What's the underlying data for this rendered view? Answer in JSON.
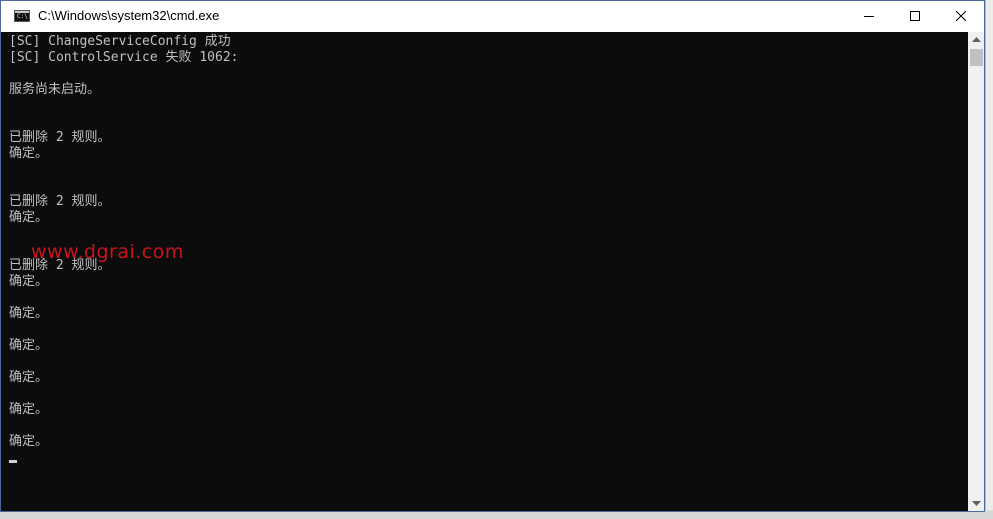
{
  "window": {
    "title": "C:\\Windows\\system32\\cmd.exe",
    "icon": "cmd-icon",
    "icon_glyph": "C:\\",
    "controls": {
      "minimize": "minimize-icon",
      "maximize": "maximize-icon",
      "close": "close-icon"
    }
  },
  "console": {
    "lines": [
      "[SC] ChangeServiceConfig 成功",
      "[SC] ControlService 失败 1062:",
      "服务尚未启动。",
      "已删除 2 规则。",
      "确定。",
      "已删除 2 规则。",
      "确定。",
      "已删除 2 规则。",
      "确定。",
      "确定。",
      "确定。",
      "确定。",
      "确定。",
      "确定。"
    ],
    "text_color": "#c0c0c0",
    "background": "#0c0c0c"
  },
  "watermark": {
    "text": "www.dgrai.com",
    "color": "#c8141e"
  },
  "scrollbar": {
    "up_icon": "scroll-up-arrow-icon",
    "down_icon": "scroll-down-arrow-icon"
  }
}
